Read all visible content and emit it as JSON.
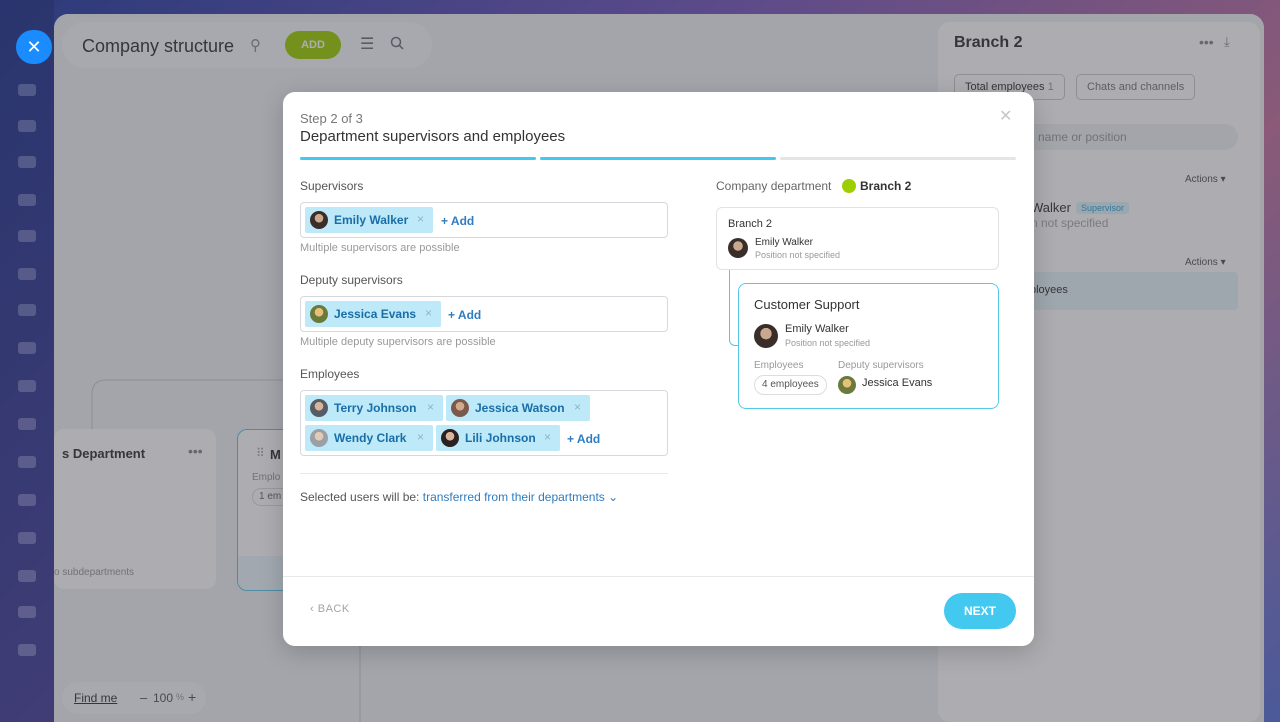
{
  "background": {
    "page_title": "Company structure",
    "add_label": "ADD",
    "dept_name": "s Department",
    "dept_sub": "o subdepartments",
    "dept2_name": "M",
    "dept2_label": "Emplo",
    "dept2_chip": "1 em",
    "find_me": "Find me",
    "zoom_minus": "–",
    "zoom_value": "100",
    "zoom_unit": "%",
    "zoom_plus": "+"
  },
  "side_panel": {
    "title": "Branch 2",
    "tab_total": "Total employees",
    "tab_total_count": "1",
    "tab_chats": "Chats and channels",
    "search_placeholder": "name or position",
    "actions_1": "Actions",
    "actions_2": "Actions",
    "supervisor_name": "Walker",
    "supervisor_badge": "Supervisor",
    "supervisor_position": "n not specified",
    "row_label": "ployees"
  },
  "modal": {
    "step": "Step 2 of 3",
    "title": "Department supervisors and employees",
    "supervisors": {
      "label": "Supervisors",
      "tags": [
        "Emily Walker"
      ],
      "add": "+ Add",
      "hint": "Multiple supervisors are possible"
    },
    "deputies": {
      "label": "Deputy supervisors",
      "tags": [
        "Jessica Evans"
      ],
      "add": "+ Add",
      "hint": "Multiple deputy supervisors are possible"
    },
    "employees": {
      "label": "Employees",
      "tags": [
        "Terry Johnson",
        "Jessica Watson",
        "Wendy Clark",
        "Lili Johnson"
      ],
      "add": "+ Add"
    },
    "transfer_prefix": "Selected users will be:",
    "transfer_link": "transferred from their departments",
    "back": "BACK",
    "next": "NEXT",
    "preview": {
      "company_label": "Company department",
      "company_name": "Branch 2",
      "parent": {
        "title": "Branch 2",
        "name": "Emily Walker",
        "position": "Position not specified"
      },
      "child": {
        "title": "Customer Support",
        "name": "Emily Walker",
        "position": "Position not specified",
        "employees_label": "Employees",
        "employees_chip": "4 employees",
        "deputy_label": "Deputy supervisors",
        "deputy_name": "Jessica Evans"
      }
    }
  },
  "colors": {
    "accent": "#43c9f0",
    "add_green": "#9dcf00",
    "tag_bg": "#bde9f8",
    "link": "#2f7cc0"
  }
}
